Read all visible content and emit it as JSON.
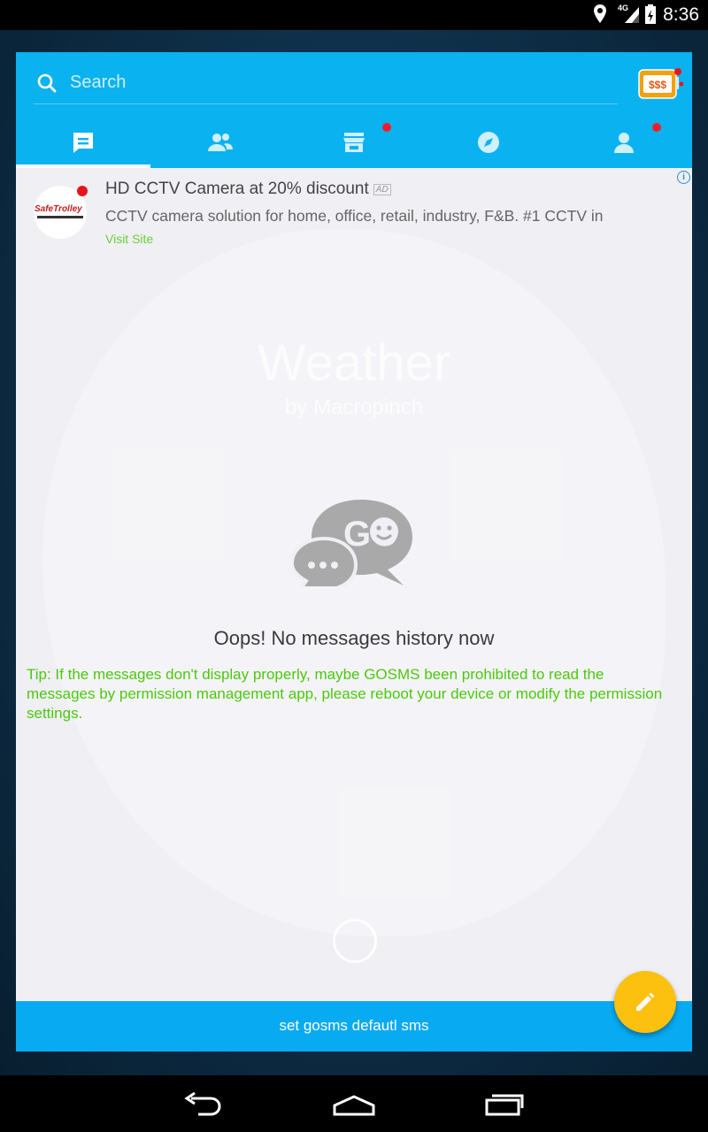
{
  "status_bar": {
    "time": "8:36",
    "network": "4G"
  },
  "search": {
    "placeholder": "Search"
  },
  "tabs": [
    {
      "id": "messages",
      "selected": true,
      "badge": false
    },
    {
      "id": "contacts",
      "selected": false,
      "badge": false
    },
    {
      "id": "store",
      "selected": false,
      "badge": true
    },
    {
      "id": "discover",
      "selected": false,
      "badge": false
    },
    {
      "id": "me",
      "selected": false,
      "badge": true
    }
  ],
  "slot_machine": {
    "label": "$$$"
  },
  "ad": {
    "logo_text": "SafeTrolley",
    "title": "HD CCTV Camera at 20% discount",
    "badge": "AD",
    "description": "CCTV camera solution for home, office, retail, industry, F&B. #1 CCTV in",
    "link": "Visit Site",
    "info": "i"
  },
  "watermark": {
    "title": "Weather",
    "subtitle": "by Macropinch"
  },
  "go_logo": {
    "text": "GO"
  },
  "empty_state": {
    "message": "Oops! No messages history now"
  },
  "tip": {
    "text": "Tip: If the messages don't display properly, maybe GOSMS been prohibited to read the messages by permission management app, please reboot your device or modify the permission settings."
  },
  "bottom_bar": {
    "label": "set gosms defautl sms"
  },
  "colors": {
    "accent": "#0ab2f0",
    "fab": "#fcc00e",
    "tip": "#4cc80e",
    "badge": "#f21c2c"
  }
}
